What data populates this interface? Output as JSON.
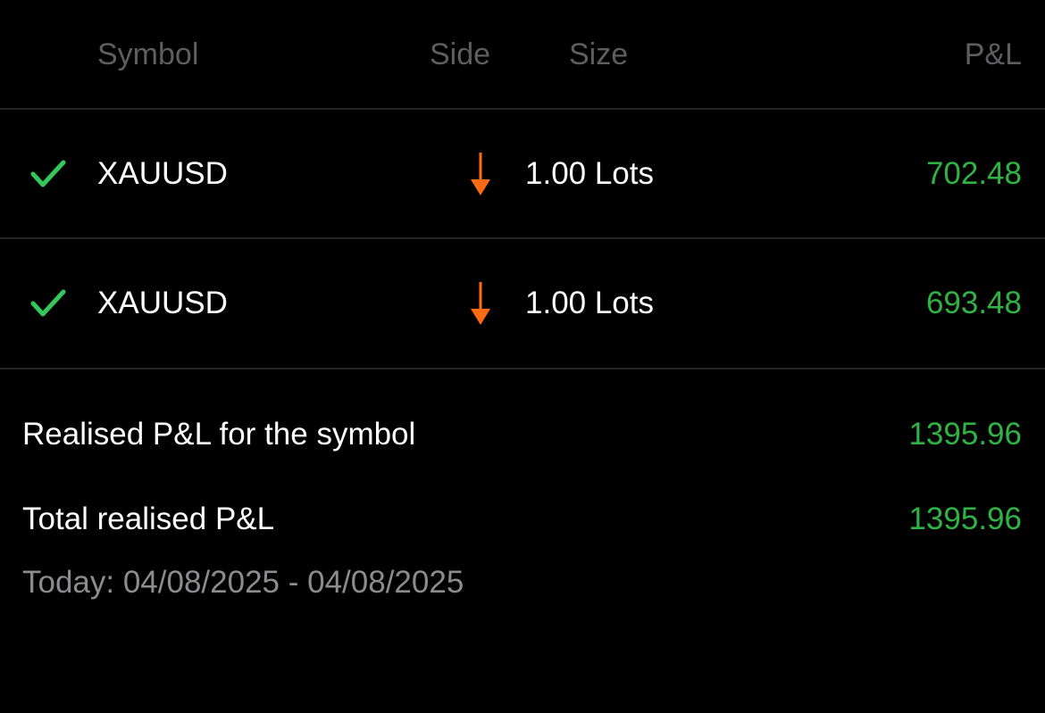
{
  "colors": {
    "background": "#000000",
    "header_text": "#5e5e60",
    "divider": "#232325",
    "profit_green": "#2fb344",
    "check_green": "#34c759",
    "sell_orange": "#ff6a13",
    "muted_text": "#8c8c8e"
  },
  "columns": {
    "symbol": "Symbol",
    "side": "Side",
    "size": "Size",
    "pnl": "P&L"
  },
  "trades": [
    {
      "status_icon": "checkmark-icon",
      "symbol": "XAUUSD",
      "side_icon": "arrow-down-icon",
      "size": "1.00 Lots",
      "pnl": "702.48"
    },
    {
      "status_icon": "checkmark-icon",
      "symbol": "XAUUSD",
      "side_icon": "arrow-down-icon",
      "size": "1.00 Lots",
      "pnl": "693.48"
    }
  ],
  "summary": {
    "symbol_label": "Realised P&L for the symbol",
    "symbol_value": "1395.96",
    "total_label": "Total realised P&L",
    "total_value": "1395.96",
    "period": "Today: 04/08/2025 - 04/08/2025"
  }
}
